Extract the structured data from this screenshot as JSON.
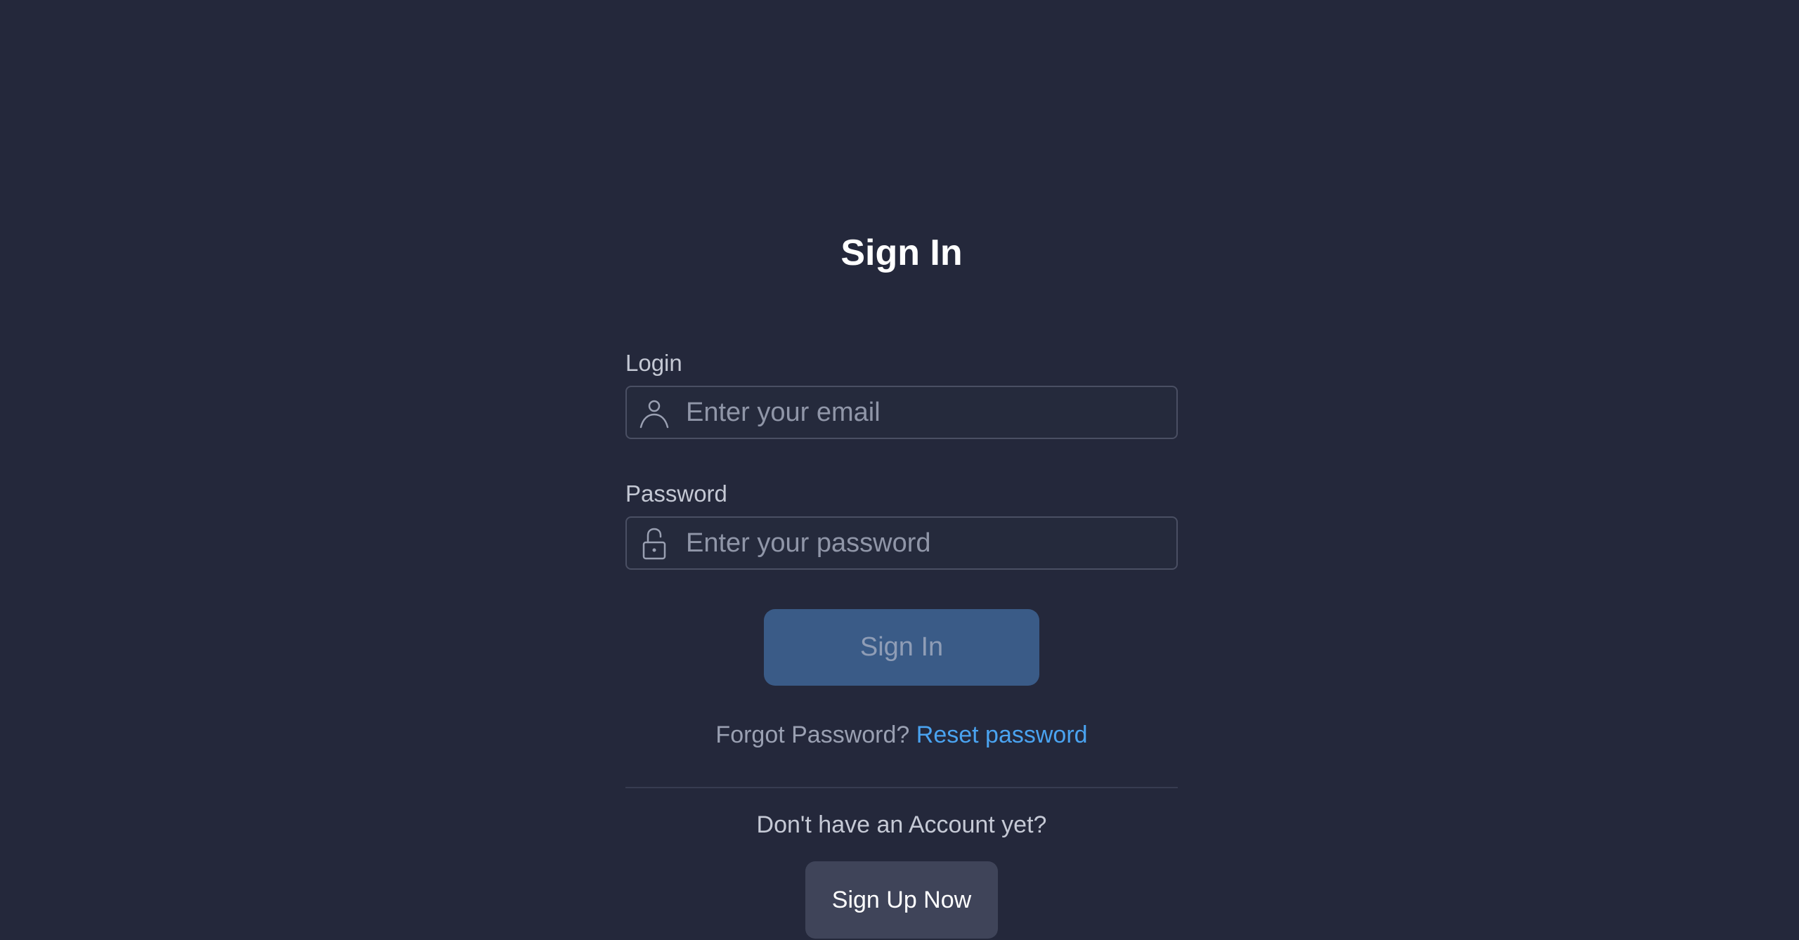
{
  "form": {
    "title": "Sign In",
    "login": {
      "label": "Login",
      "placeholder": "Enter your email",
      "value": "",
      "icon": "user-icon"
    },
    "password": {
      "label": "Password",
      "placeholder": "Enter your password",
      "value": "",
      "icon": "unlock-icon"
    },
    "sign_in_label": "Sign In",
    "forgot_text": "Forgot Password?",
    "reset_link": "Reset password",
    "no_account_text": "Don't have an Account yet?",
    "sign_up_label": "Sign Up Now"
  },
  "colors": {
    "background": "#24283b",
    "primary_button": "#3a5b87",
    "link": "#4aa3f0",
    "secondary_button": "#3f4459"
  }
}
